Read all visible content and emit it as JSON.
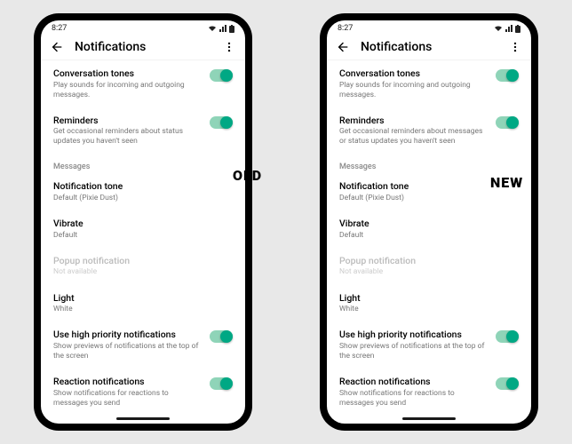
{
  "labels": {
    "old": "OLD",
    "new": "NEW"
  },
  "old": {
    "time": "8:27",
    "header_title": "Notifications",
    "rows": {
      "conv": {
        "title": "Conversation tones",
        "sub": "Play sounds for incoming and outgoing messages."
      },
      "rem": {
        "title": "Reminders",
        "sub": "Get occasional reminders about status updates you haven't seen"
      },
      "section": "Messages",
      "tone": {
        "title": "Notification tone",
        "sub": "Default (Pixie Dust)"
      },
      "vib": {
        "title": "Vibrate",
        "sub": "Default"
      },
      "popup": {
        "title": "Popup notification",
        "sub": "Not available"
      },
      "light": {
        "title": "Light",
        "sub": "White"
      },
      "hp": {
        "title": "Use high priority notifications",
        "sub": "Show previews of notifications at the top of the screen"
      },
      "react": {
        "title": "Reaction notifications",
        "sub": "Show notifications for reactions to messages you send"
      }
    }
  },
  "new": {
    "time": "8:27",
    "header_title": "Notifications",
    "rows": {
      "conv": {
        "title": "Conversation tones",
        "sub": "Play sounds for incoming and outgoing messages."
      },
      "rem": {
        "title": "Reminders",
        "sub": "Get occasional reminders about messages or status updates you haven't seen"
      },
      "section": "Messages",
      "tone": {
        "title": "Notification tone",
        "sub": "Default (Pixie Dust)"
      },
      "vib": {
        "title": "Vibrate",
        "sub": "Default"
      },
      "popup": {
        "title": "Popup notification",
        "sub": "Not available"
      },
      "light": {
        "title": "Light",
        "sub": "White"
      },
      "hp": {
        "title": "Use high priority notifications",
        "sub": "Show previews of notifications at the top of the screen"
      },
      "react": {
        "title": "Reaction notifications",
        "sub": "Show notifications for reactions to messages you send"
      }
    }
  }
}
